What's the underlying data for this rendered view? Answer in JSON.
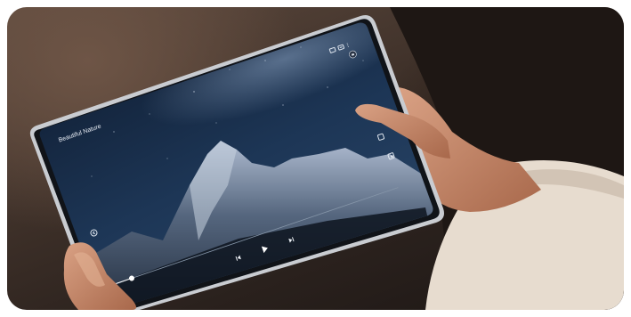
{
  "video": {
    "title": "Beautiful Nature"
  },
  "colors": {
    "tablet_frame": "#c9ccd1",
    "sky_top": "#0d1a2e",
    "sky_mid": "#1f3a5c",
    "mountain": "#8c9bb0",
    "accent_progress": "#ffffff"
  },
  "icons": [
    "cast-icon",
    "captions-icon",
    "more-options-icon",
    "lock-icon",
    "back-arrow-icon",
    "rotate-screen-icon",
    "pip-icon",
    "previous-icon",
    "play-icon",
    "next-icon",
    "nav-back-icon",
    "nav-home-icon",
    "nav-recents-icon"
  ],
  "playback": {
    "progress_fraction": 0.07
  }
}
